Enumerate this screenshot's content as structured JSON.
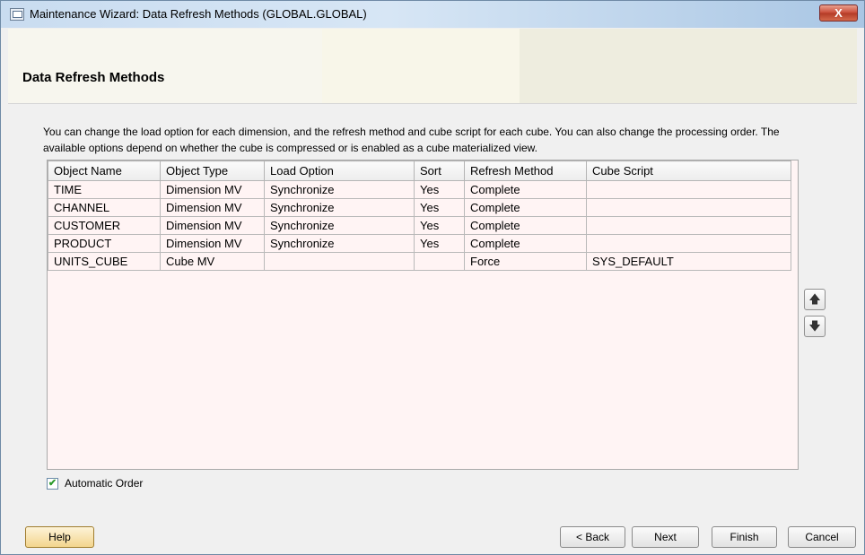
{
  "window": {
    "title": "Maintenance Wizard: Data Refresh Methods (GLOBAL.GLOBAL)",
    "close_label": "X"
  },
  "header": {
    "title": "Data Refresh Methods"
  },
  "description": "You can change the load option for each dimension, and the refresh method and cube script for each cube. You can also change the processing order. The available options depend on whether the cube is compressed or is enabled as a cube materialized view.",
  "table": {
    "columns": [
      "Object Name",
      "Object Type",
      "Load Option",
      "Sort",
      "Refresh Method",
      "Cube Script"
    ],
    "rows": [
      [
        "TIME",
        "Dimension MV",
        "Synchronize",
        "Yes",
        "Complete",
        ""
      ],
      [
        "CHANNEL",
        "Dimension MV",
        "Synchronize",
        "Yes",
        "Complete",
        ""
      ],
      [
        "CUSTOMER",
        "Dimension MV",
        "Synchronize",
        "Yes",
        "Complete",
        ""
      ],
      [
        "PRODUCT",
        "Dimension MV",
        "Synchronize",
        "Yes",
        "Complete",
        ""
      ],
      [
        "UNITS_CUBE",
        "Cube MV",
        "",
        "",
        "Force",
        "SYS_DEFAULT"
      ]
    ]
  },
  "order_buttons": {
    "up_icon": "arrow-up-icon",
    "down_icon": "arrow-down-icon",
    "up_glyph": "🡅",
    "down_glyph": "🡇"
  },
  "automatic_order": {
    "label": "Automatic Order",
    "checked": true,
    "glyph": "✔"
  },
  "buttons": {
    "help": "Help",
    "back": "< Back",
    "next": "Next",
    "finish": "Finish",
    "cancel": "Cancel"
  }
}
